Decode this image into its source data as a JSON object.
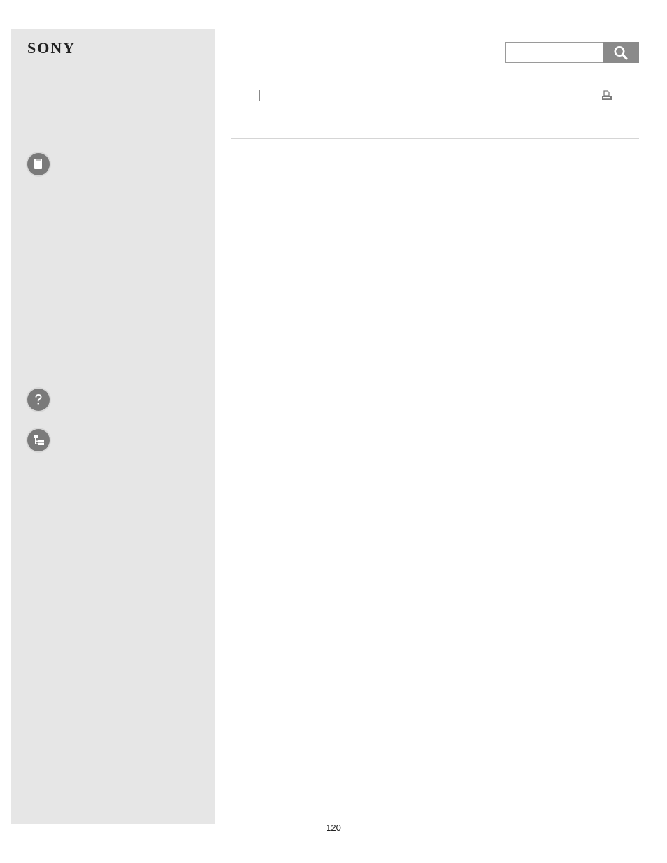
{
  "brand": {
    "logo_text": "SONY"
  },
  "search": {
    "placeholder": "",
    "value": "",
    "button_icon": "search-icon"
  },
  "toolbar": {
    "print_icon": "print-icon"
  },
  "sidebar": {
    "icons": [
      "book-icon",
      "help-icon",
      "tree-icon"
    ]
  },
  "footer": {
    "page_number": "120"
  },
  "colors": {
    "sidebar_bg": "#e6e6e6",
    "icon_bg": "#7a7a7a",
    "search_button_bg": "#8a8a8a"
  }
}
